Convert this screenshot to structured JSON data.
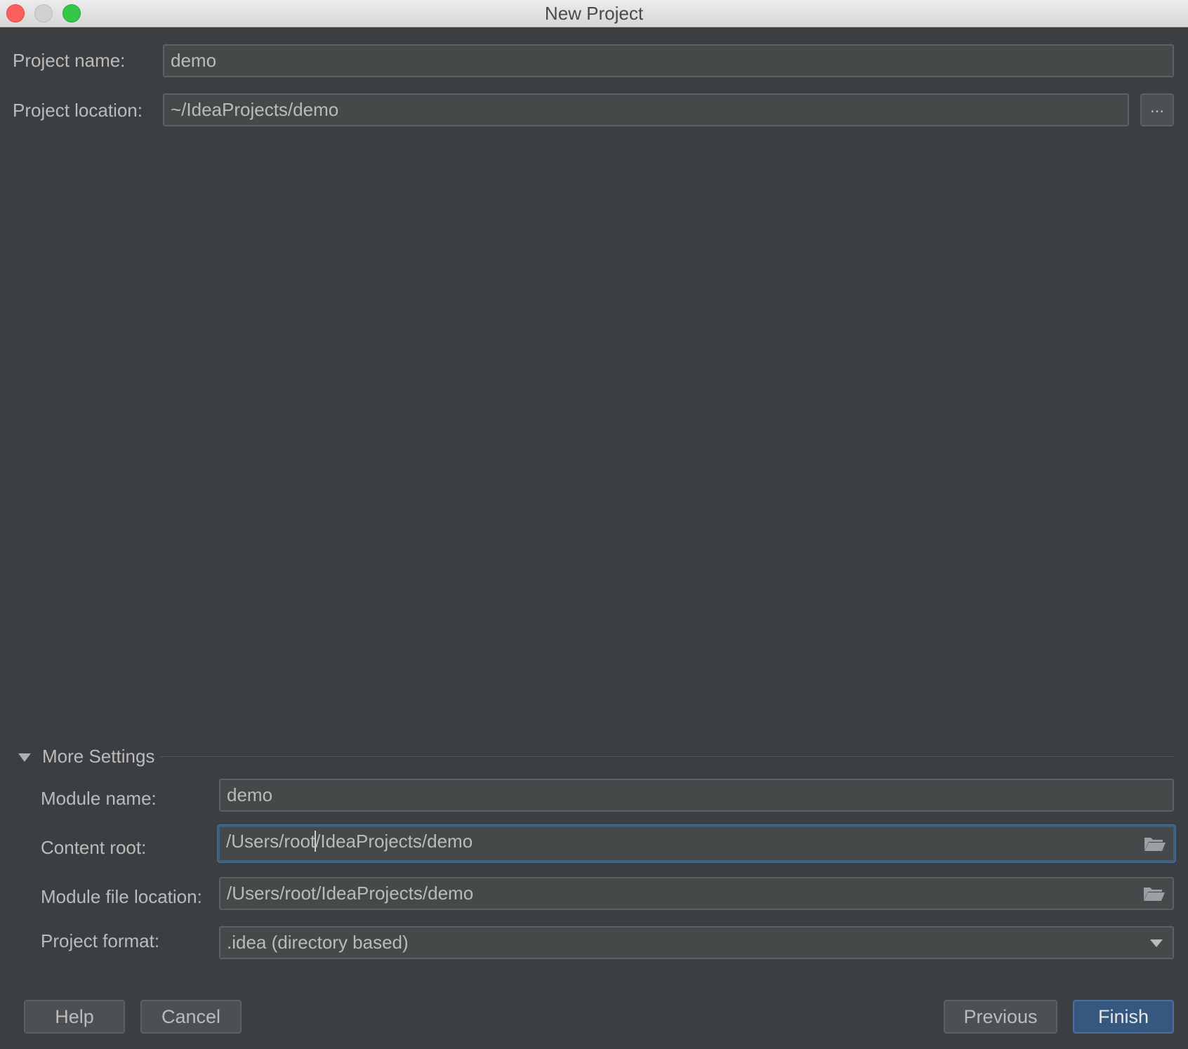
{
  "window": {
    "title": "New Project"
  },
  "project": {
    "name_label": "Project name:",
    "name_value": "demo",
    "location_label": "Project location:",
    "location_value": "~/IdeaProjects/demo",
    "browse_label": "..."
  },
  "more_settings": {
    "label": "More Settings",
    "expanded": true,
    "module_name_label": "Module name:",
    "module_name_value": "demo",
    "content_root_label": "Content root:",
    "content_root_before_caret": "/Users/root",
    "content_root_after_caret": "/IdeaProjects/demo",
    "module_file_label": "Module file location:",
    "module_file_value": "/Users/root/IdeaProjects/demo",
    "format_label": "Project format:",
    "format_value": ".idea (directory based)"
  },
  "buttons": {
    "help": "Help",
    "cancel": "Cancel",
    "previous": "Previous",
    "finish": "Finish"
  },
  "icons": {
    "folder": "folder-icon",
    "expand": "triangle-down-icon",
    "dropdown": "chevron-down-icon"
  },
  "colors": {
    "background": "#3c3f41",
    "field_bg": "#45494a",
    "focus_border": "#3d6185",
    "primary_button": "#365880"
  }
}
